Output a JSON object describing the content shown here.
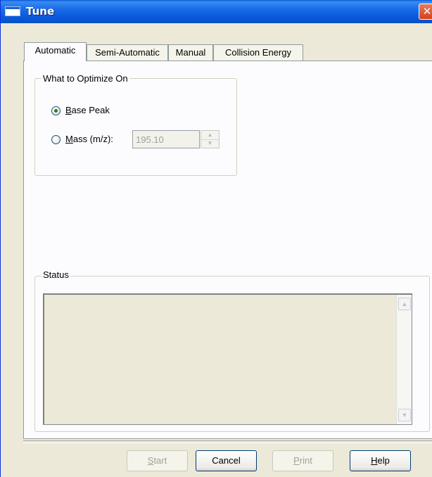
{
  "window": {
    "title": "Tune",
    "close_icon": "close-icon"
  },
  "tabs": [
    {
      "label": "Automatic",
      "active": true
    },
    {
      "label": "Semi-Automatic",
      "active": false
    },
    {
      "label": "Manual",
      "active": false
    },
    {
      "label": "Collision Energy",
      "active": false
    }
  ],
  "optimize": {
    "legend": "What to Optimize On",
    "base_peak": {
      "accel": "B",
      "rest": "ase Peak",
      "checked": true
    },
    "mass": {
      "accel": "M",
      "rest": "ass (m/z):",
      "checked": false,
      "value": "195.10",
      "disabled": true
    }
  },
  "status": {
    "legend": "Status",
    "text": ""
  },
  "buttons": {
    "start": {
      "accel": "S",
      "rest": "tart",
      "disabled": true
    },
    "cancel": {
      "label": "Cancel",
      "disabled": false
    },
    "print": {
      "accel": "P",
      "rest": "rint",
      "disabled": true
    },
    "help": {
      "accel": "H",
      "rest": "elp",
      "disabled": false
    }
  },
  "colors": {
    "titlebar": "#0a5bd8",
    "dialog": "#ece9d8",
    "close": "#d4421c"
  }
}
